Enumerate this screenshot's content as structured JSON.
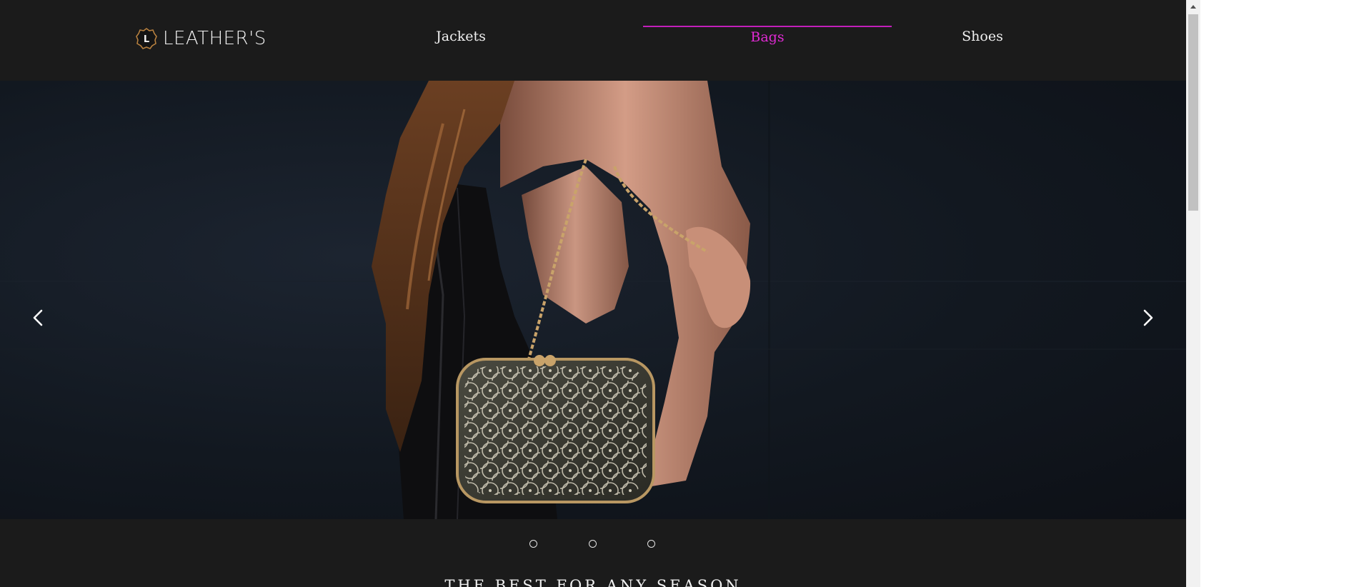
{
  "header": {
    "logo_text": "LEATHER'S",
    "logo_letter": "L",
    "nav": {
      "jackets": "Jackets",
      "bags": "Bags",
      "shoes": "Shoes"
    },
    "active_color": "#e22ad5"
  },
  "slider": {
    "prev_icon": "chevron-left-icon",
    "next_icon": "chevron-right-icon",
    "dots_count": 3
  },
  "tagline": "THE BEST FOR ANY SEASON",
  "colors": {
    "background": "#1b1b1b",
    "accent": "#c21fbb",
    "text": "#f0f0f0"
  }
}
